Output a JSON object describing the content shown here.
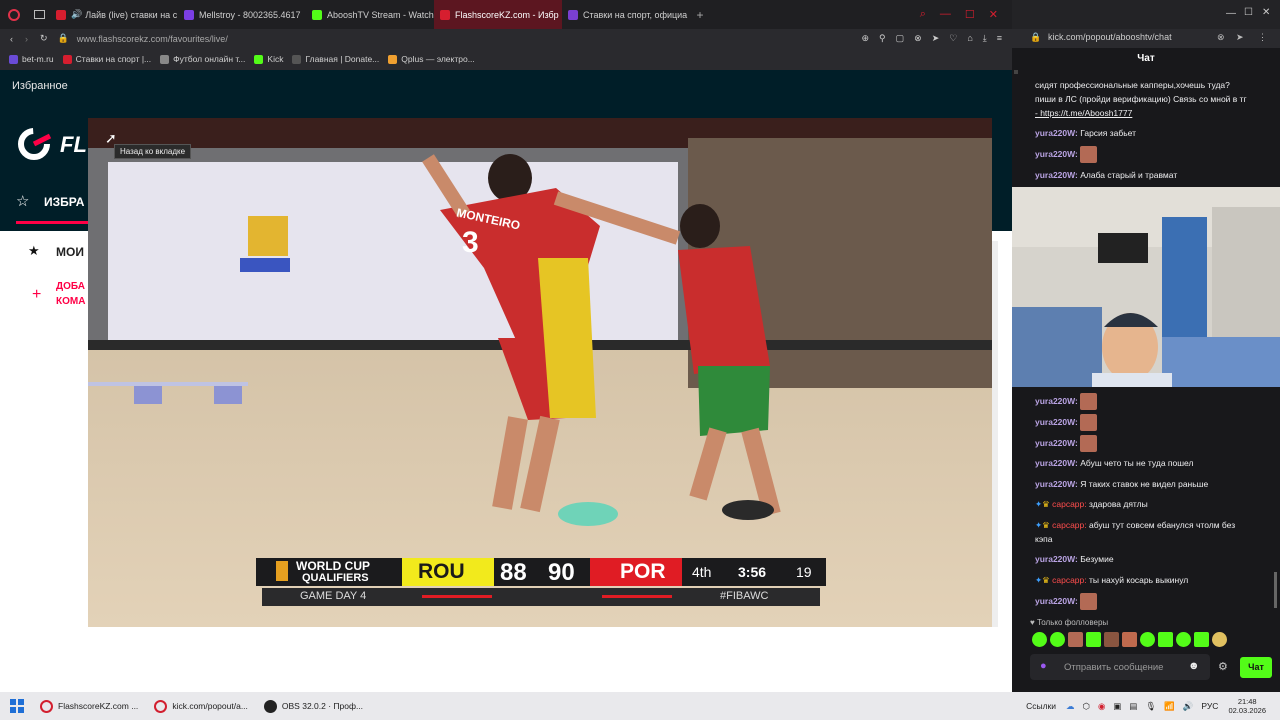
{
  "tabs": [
    {
      "label": "Лайв (live) ставки на с",
      "color": "#d61e2f"
    },
    {
      "label": "Mellstroy - 8002365.4617",
      "color": "#7b3fe4"
    },
    {
      "label": "AbooshTV Stream - Watch",
      "color": "#53fc18"
    },
    {
      "label": "FlashscoreKZ.com - Избр",
      "color": "#d61e2f"
    },
    {
      "label": "Ставки на спорт, официа",
      "color": "#7a3fd1"
    }
  ],
  "address": "www.flashscorekz.com/favourites/live/",
  "bookmarks": [
    {
      "label": "bet-m.ru",
      "color": "#6a4bd6"
    },
    {
      "label": "Ставки на спорт |...",
      "color": "#d61e2f"
    },
    {
      "label": "Футбол онлайн т...",
      "color": "#888888"
    },
    {
      "label": "Kick",
      "color": "#53fc18"
    },
    {
      "label": "Главная | Donate...",
      "color": "#555555"
    },
    {
      "label": "Qplus — электро...",
      "color": "#f0a030"
    }
  ],
  "flashscore": {
    "page_label": "Избранное",
    "logo_text": "FL",
    "favorites_tab": "ИЗБРА",
    "my_label": "МОИ",
    "add_label_1": "ДОБА",
    "add_label_2": "КОМА",
    "tooltip": "Назад ко вкладке"
  },
  "scoreboard": {
    "competition_1": "WORLD CUP",
    "competition_2": "QUALIFIERS",
    "game_day": "GAME DAY 4",
    "home_team": "ROU",
    "home_score": "88",
    "away_score": "90",
    "away_team": "POR",
    "period": "4th",
    "clock": "3:56",
    "shot_clock": "19",
    "hashtag": "#FIBAWC"
  },
  "player": {
    "number": "3",
    "name": "MONTEIRO"
  },
  "popout": {
    "address": "kick.com/popout/abooshtv/chat",
    "chat_title": "Чат"
  },
  "chat_top": [
    {
      "text": "сидят профессиональные капперы,хочешь туда?"
    },
    {
      "text": "пиши в ЛС (пройди верификацию) Связь со мной в тг"
    },
    {
      "text": "- https://t.me/Aboosh1777"
    },
    {
      "user": "yura220W:",
      "text": "Гарсия забьет"
    },
    {
      "user": "yura220W:",
      "text": ""
    },
    {
      "user": "yura220W:",
      "text": "Алаба старый и травмат"
    }
  ],
  "chat_bottom": [
    {
      "user": "yura220W:",
      "text": "",
      "emote": true
    },
    {
      "user": "yura220W:",
      "text": "",
      "emote": true
    },
    {
      "user": "yura220W:",
      "text": "",
      "emote": true
    },
    {
      "user": "yura220W:",
      "text": "Абуш чето ты не туда пошел"
    },
    {
      "user": "yura220W:",
      "text": "Я таких ставок не видел раньше"
    },
    {
      "user": "сарсарр:",
      "text": "здарова дятлы",
      "red": true
    },
    {
      "user": "сарсарр:",
      "text": "абуш тут совсем ебанулся чтолм без",
      "red": true
    },
    {
      "user": "",
      "text": "кэпа"
    },
    {
      "user": "yura220W:",
      "text": "Безумие"
    },
    {
      "user": "сарсарр:",
      "text": "ты нахуй косарь выкинул",
      "red": true
    },
    {
      "user": "yura220W:",
      "text": "",
      "emote": true
    }
  ],
  "chat_footer": {
    "followers_only": "Только фолловеры",
    "placeholder": "Отправить сообщение",
    "send_label": "Чат"
  },
  "taskbar": {
    "items": [
      "FlashscoreKZ.com ...",
      "kick.com/popout/a...",
      "OBS 32.0.2 · Проф..."
    ],
    "links_label": "Ссылки",
    "lang": "РУС",
    "time": "21:48",
    "date": "02.03.2026"
  },
  "colors": {
    "accent": "#ff0046",
    "kick_green": "#53fc18",
    "flashscore_dark": "#001e28"
  }
}
